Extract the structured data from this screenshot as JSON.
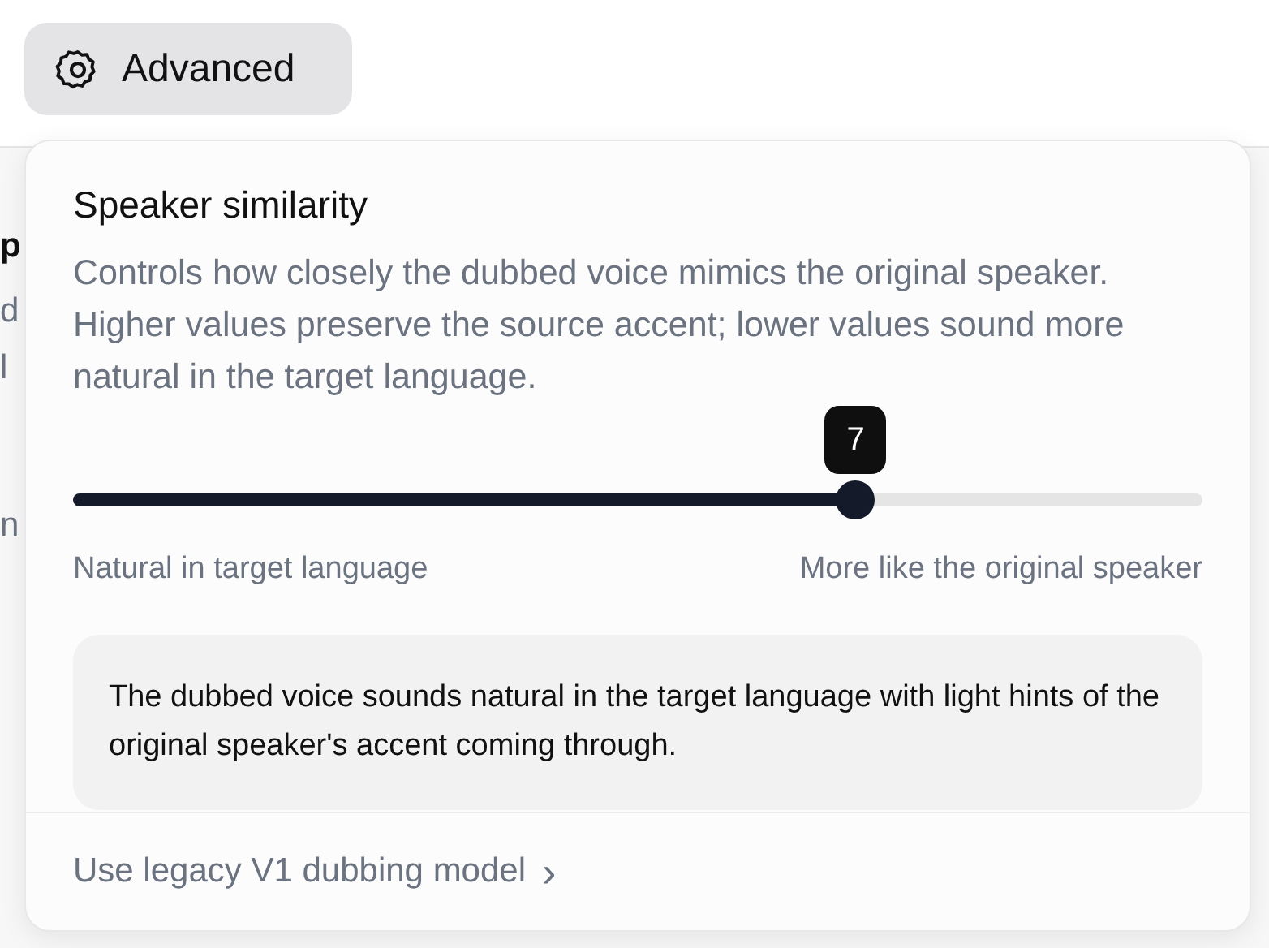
{
  "advanced_button": {
    "label": "Advanced"
  },
  "background_fragments": [
    "p",
    "d",
    "l",
    "n"
  ],
  "popover": {
    "title": "Speaker similarity",
    "description": "Controls how closely the dubbed voice mimics the original speaker. Higher values preserve the source accent; lower values sound more natural in the target language.",
    "slider": {
      "level": 0.693,
      "value_tooltip": "7",
      "min_label": "Natural in target language",
      "max_label": "More like the original speaker"
    },
    "info": "The dubbed voice sounds natural in the target language with light hints of the original speaker's accent coming through.",
    "footer_link": "Use legacy V1 dubbing model",
    "footer_chevron": "›"
  }
}
